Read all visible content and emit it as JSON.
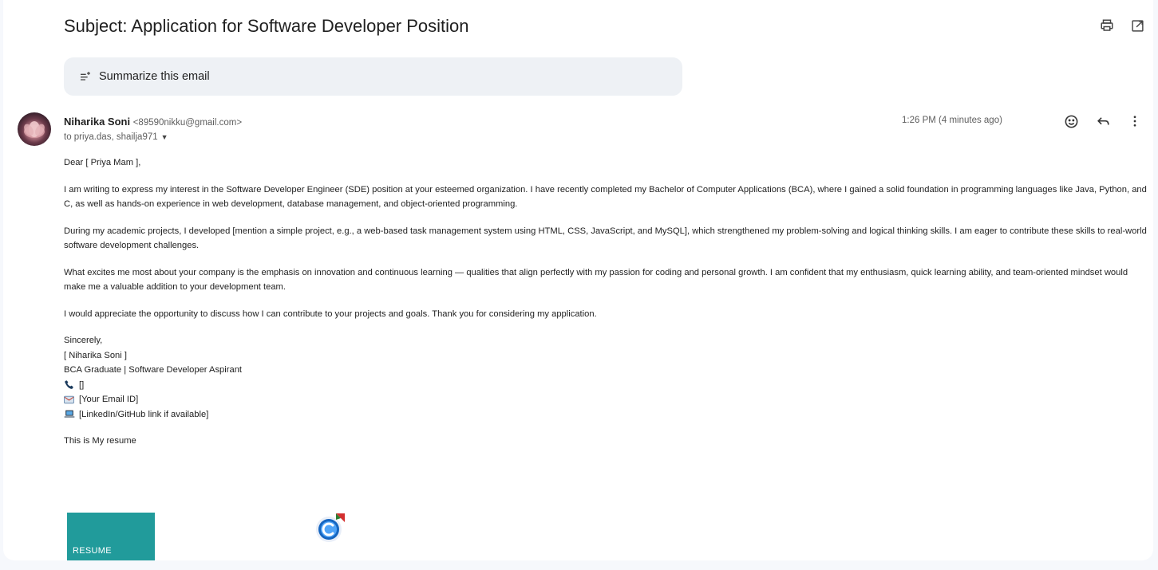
{
  "email": {
    "subject": "Subject: Application for Software Developer Position",
    "summarize_label": "Summarize this email",
    "sender": {
      "name": "Niharika Soni",
      "email": "<89590nikku@gmail.com>"
    },
    "recipients": "to priya.das, shailja971",
    "timestamp": "1:26 PM (4 minutes ago)",
    "body": {
      "greeting": "Dear [ Priya Mam ],",
      "paragraphs": [
        "I am writing to express my interest in the Software Developer Engineer (SDE) position at your esteemed organization. I have recently completed my Bachelor of Computer Applications (BCA), where I gained a solid foundation in programming languages like Java, Python, and C, as well as hands-on experience in web development, database management, and object-oriented programming.",
        "During my academic projects, I developed [mention a simple project, e.g., a web-based task management system using HTML, CSS, JavaScript, and MySQL], which strengthened my problem-solving and logical thinking skills. I am eager to contribute these skills to real-world software development challenges.",
        "What excites me most about your company is the emphasis on innovation and continuous learning — qualities that align perfectly with my passion for coding and personal growth. I am confident that my enthusiasm, quick learning ability, and team-oriented mindset would make me a valuable addition to your development team.",
        "I would appreciate the opportunity to discuss how I can contribute to your projects and goals. Thank you for considering my application."
      ],
      "signature": {
        "closing": "Sincerely,",
        "name": "[ Niharika Soni ]",
        "title": "BCA Graduate | Software Developer Aspirant",
        "phone": "[]",
        "email": "[Your Email ID]",
        "link": "[LinkedIn/GitHub link if available]"
      },
      "closing_note": "This is My resume"
    },
    "attachment": {
      "label": "RESUME",
      "color": "#219b9b"
    }
  },
  "icons": {
    "print": "printer-icon",
    "open_new_window": "open-in-new-window-icon",
    "summarize": "summarize-sparkle-icon",
    "emoji_react": "emoji-smiley-icon",
    "reply": "reply-arrow-icon",
    "more": "more-vertical-icon",
    "dropdown": "chevron-down-icon",
    "phone": "phone-icon",
    "mail": "envelope-icon",
    "laptop": "laptop-icon",
    "extension": "extension-c-icon"
  },
  "colors": {
    "background": "#f6f8fc",
    "panel": "#ffffff",
    "summarize_bg": "#eef1f5",
    "muted_text": "#5e5e5e"
  }
}
